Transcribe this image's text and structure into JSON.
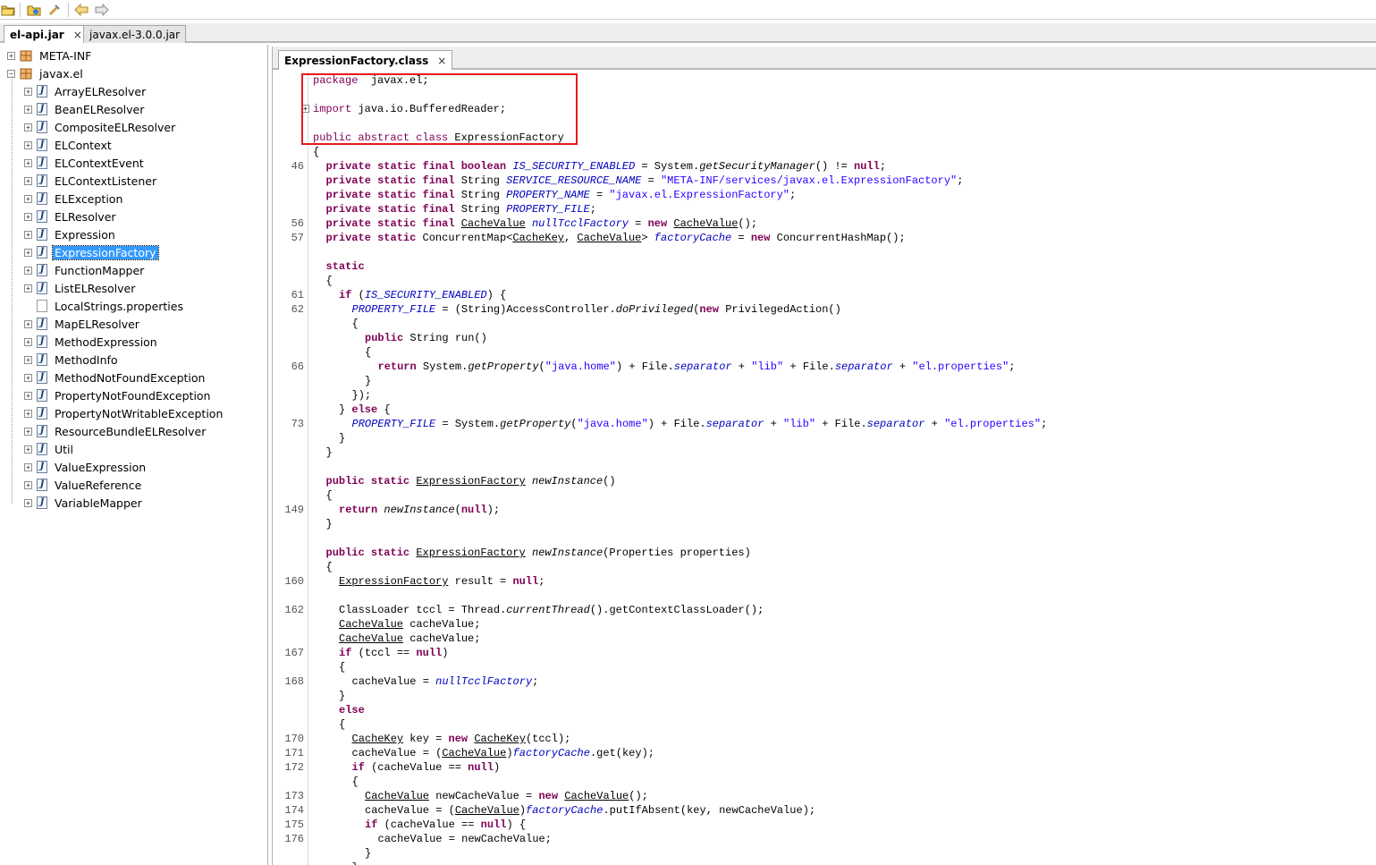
{
  "toolbar": {
    "buttons": [
      {
        "name": "open-file-icon",
        "glyph": "📂"
      },
      {
        "name": "open-jar-icon",
        "glyph": "📦"
      },
      {
        "name": "tools-icon",
        "glyph": "🔧"
      },
      {
        "name": "back-arrow-icon",
        "glyph": "⇦"
      },
      {
        "name": "forward-arrow-icon",
        "glyph": "⇨"
      }
    ]
  },
  "file_tabs": [
    {
      "label": "el-api.jar",
      "active": true,
      "close": "×"
    },
    {
      "label": "javax.el-3.0.0.jar",
      "active": false
    }
  ],
  "tree": {
    "roots": [
      {
        "label": "META-INF",
        "expander": "+"
      },
      {
        "label": "javax.el",
        "expander": "−"
      }
    ],
    "children": [
      {
        "label": "ArrayELResolver"
      },
      {
        "label": "BeanELResolver"
      },
      {
        "label": "CompositeELResolver"
      },
      {
        "label": "ELContext"
      },
      {
        "label": "ELContextEvent"
      },
      {
        "label": "ELContextListener"
      },
      {
        "label": "ELException"
      },
      {
        "label": "ELResolver"
      },
      {
        "label": "Expression"
      },
      {
        "label": "ExpressionFactory",
        "selected": true
      },
      {
        "label": "FunctionMapper"
      },
      {
        "label": "ListELResolver"
      },
      {
        "label": "LocalStrings.properties",
        "file": true
      },
      {
        "label": "MapELResolver"
      },
      {
        "label": "MethodExpression"
      },
      {
        "label": "MethodInfo"
      },
      {
        "label": "MethodNotFoundException"
      },
      {
        "label": "PropertyNotFoundException"
      },
      {
        "label": "PropertyNotWritableException"
      },
      {
        "label": "ResourceBundleELResolver"
      },
      {
        "label": "Util"
      },
      {
        "label": "ValueExpression"
      },
      {
        "label": "ValueReference"
      },
      {
        "label": "VariableMapper"
      }
    ]
  },
  "editor": {
    "tab_label": "ExpressionFactory.class",
    "tab_close": "×",
    "highlight_color": "#e8191b",
    "lines": [
      {
        "ln": "",
        "indent": 0,
        "parts": [
          [
            "kw2",
            "package"
          ],
          [
            "",
            "  javax.el;"
          ]
        ]
      },
      {
        "ln": "",
        "indent": 0,
        "parts": []
      },
      {
        "ln": "",
        "indent": 0,
        "fold": "+",
        "parts": [
          [
            "kw2",
            "import"
          ],
          [
            "",
            " java.io.BufferedReader;"
          ]
        ]
      },
      {
        "ln": "",
        "indent": 0,
        "parts": []
      },
      {
        "ln": "",
        "indent": 0,
        "parts": [
          [
            "kw2",
            "public abstract class"
          ],
          [
            "",
            " ExpressionFactory"
          ]
        ]
      },
      {
        "ln": "",
        "indent": 0,
        "parts": [
          [
            "",
            "{"
          ]
        ]
      },
      {
        "ln": "46",
        "indent": 1,
        "parts": [
          [
            "kw",
            "private static final boolean"
          ],
          [
            "",
            " "
          ],
          [
            "fld",
            "IS_SECURITY_ENABLED"
          ],
          [
            "",
            " = System."
          ],
          [
            "it",
            "getSecurityManager"
          ],
          [
            "",
            "() != "
          ],
          [
            "kw",
            "null"
          ],
          [
            "",
            ";"
          ]
        ]
      },
      {
        "ln": "",
        "indent": 1,
        "parts": [
          [
            "kw",
            "private static final"
          ],
          [
            "",
            " String "
          ],
          [
            "fld",
            "SERVICE_RESOURCE_NAME"
          ],
          [
            "",
            " = "
          ],
          [
            "str",
            "\"META-INF/services/javax.el.ExpressionFactory\""
          ],
          [
            "",
            ";"
          ]
        ]
      },
      {
        "ln": "",
        "indent": 1,
        "parts": [
          [
            "kw",
            "private static final"
          ],
          [
            "",
            " String "
          ],
          [
            "fld",
            "PROPERTY_NAME"
          ],
          [
            "",
            " = "
          ],
          [
            "str",
            "\"javax.el.ExpressionFactory\""
          ],
          [
            "",
            ";"
          ]
        ]
      },
      {
        "ln": "",
        "indent": 1,
        "parts": [
          [
            "kw",
            "private static final"
          ],
          [
            "",
            " String "
          ],
          [
            "fld",
            "PROPERTY_FILE"
          ],
          [
            "",
            ";"
          ]
        ]
      },
      {
        "ln": "56",
        "indent": 1,
        "parts": [
          [
            "kw",
            "private static final"
          ],
          [
            "",
            " "
          ],
          [
            "ul",
            "CacheValue"
          ],
          [
            "",
            " "
          ],
          [
            "fld",
            "nullTcclFactory"
          ],
          [
            "",
            " = "
          ],
          [
            "kw",
            "new"
          ],
          [
            "",
            " "
          ],
          [
            "ul",
            "CacheValue"
          ],
          [
            "",
            "();"
          ]
        ]
      },
      {
        "ln": "57",
        "indent": 1,
        "parts": [
          [
            "kw",
            "private static"
          ],
          [
            "",
            " ConcurrentMap<"
          ],
          [
            "ul",
            "CacheKey"
          ],
          [
            "",
            ", "
          ],
          [
            "ul",
            "CacheValue"
          ],
          [
            "",
            "> "
          ],
          [
            "fld",
            "factoryCache"
          ],
          [
            "",
            " = "
          ],
          [
            "kw",
            "new"
          ],
          [
            "",
            " ConcurrentHashMap();"
          ]
        ]
      },
      {
        "ln": "",
        "indent": 0,
        "parts": []
      },
      {
        "ln": "",
        "indent": 1,
        "parts": [
          [
            "kw",
            "static"
          ]
        ]
      },
      {
        "ln": "",
        "indent": 1,
        "parts": [
          [
            "",
            "{"
          ]
        ]
      },
      {
        "ln": "61",
        "indent": 2,
        "parts": [
          [
            "kw",
            "if"
          ],
          [
            "",
            " ("
          ],
          [
            "fld",
            "IS_SECURITY_ENABLED"
          ],
          [
            "",
            ") {"
          ]
        ]
      },
      {
        "ln": "62",
        "indent": 3,
        "parts": [
          [
            "fld",
            "PROPERTY_FILE"
          ],
          [
            "",
            " = (String)AccessController."
          ],
          [
            "it",
            "doPrivileged"
          ],
          [
            "",
            "("
          ],
          [
            "kw",
            "new"
          ],
          [
            "",
            " PrivilegedAction()"
          ]
        ]
      },
      {
        "ln": "",
        "indent": 3,
        "parts": [
          [
            "",
            "{"
          ]
        ]
      },
      {
        "ln": "",
        "indent": 4,
        "parts": [
          [
            "kw",
            "public"
          ],
          [
            "",
            " String run()"
          ]
        ]
      },
      {
        "ln": "",
        "indent": 4,
        "parts": [
          [
            "",
            "{"
          ]
        ]
      },
      {
        "ln": "66",
        "indent": 5,
        "parts": [
          [
            "kw",
            "return"
          ],
          [
            "",
            " System."
          ],
          [
            "it",
            "getProperty"
          ],
          [
            "",
            "("
          ],
          [
            "str",
            "\"java.home\""
          ],
          [
            "",
            ") + File."
          ],
          [
            "fld",
            "separator"
          ],
          [
            "",
            " + "
          ],
          [
            "str",
            "\"lib\""
          ],
          [
            "",
            " + File."
          ],
          [
            "fld",
            "separator"
          ],
          [
            "",
            " + "
          ],
          [
            "str",
            "\"el.properties\""
          ],
          [
            "",
            ";"
          ]
        ]
      },
      {
        "ln": "",
        "indent": 4,
        "parts": [
          [
            "",
            "}"
          ]
        ]
      },
      {
        "ln": "",
        "indent": 3,
        "parts": [
          [
            "",
            "});"
          ]
        ]
      },
      {
        "ln": "",
        "indent": 2,
        "parts": [
          [
            "",
            "} "
          ],
          [
            "kw",
            "else"
          ],
          [
            "",
            " {"
          ]
        ]
      },
      {
        "ln": "73",
        "indent": 3,
        "parts": [
          [
            "fld",
            "PROPERTY_FILE"
          ],
          [
            "",
            " = System."
          ],
          [
            "it",
            "getProperty"
          ],
          [
            "",
            "("
          ],
          [
            "str",
            "\"java.home\""
          ],
          [
            "",
            ") + File."
          ],
          [
            "fld",
            "separator"
          ],
          [
            "",
            " + "
          ],
          [
            "str",
            "\"lib\""
          ],
          [
            "",
            " + File."
          ],
          [
            "fld",
            "separator"
          ],
          [
            "",
            " + "
          ],
          [
            "str",
            "\"el.properties\""
          ],
          [
            "",
            ";"
          ]
        ]
      },
      {
        "ln": "",
        "indent": 2,
        "parts": [
          [
            "",
            "}"
          ]
        ]
      },
      {
        "ln": "",
        "indent": 1,
        "parts": [
          [
            "",
            "}"
          ]
        ]
      },
      {
        "ln": "",
        "indent": 0,
        "parts": []
      },
      {
        "ln": "",
        "indent": 1,
        "parts": [
          [
            "kw",
            "public static"
          ],
          [
            "",
            " "
          ],
          [
            "ul",
            "ExpressionFactory"
          ],
          [
            "",
            " "
          ],
          [
            "it",
            "newInstance"
          ],
          [
            "",
            "()"
          ]
        ]
      },
      {
        "ln": "",
        "indent": 1,
        "parts": [
          [
            "",
            "{"
          ]
        ]
      },
      {
        "ln": "149",
        "indent": 2,
        "parts": [
          [
            "kw",
            "return"
          ],
          [
            "",
            " "
          ],
          [
            "it",
            "newInstance"
          ],
          [
            "",
            "("
          ],
          [
            "kw",
            "null"
          ],
          [
            "",
            ");"
          ]
        ]
      },
      {
        "ln": "",
        "indent": 1,
        "parts": [
          [
            "",
            "}"
          ]
        ]
      },
      {
        "ln": "",
        "indent": 0,
        "parts": []
      },
      {
        "ln": "",
        "indent": 1,
        "parts": [
          [
            "kw",
            "public static"
          ],
          [
            "",
            " "
          ],
          [
            "ul",
            "ExpressionFactory"
          ],
          [
            "",
            " "
          ],
          [
            "it",
            "newInstance"
          ],
          [
            "",
            "(Properties properties)"
          ]
        ]
      },
      {
        "ln": "",
        "indent": 1,
        "parts": [
          [
            "",
            "{"
          ]
        ]
      },
      {
        "ln": "160",
        "indent": 2,
        "parts": [
          [
            "ul",
            "ExpressionFactory"
          ],
          [
            "",
            " result = "
          ],
          [
            "kw",
            "null"
          ],
          [
            "",
            ";"
          ]
        ]
      },
      {
        "ln": "",
        "indent": 0,
        "parts": []
      },
      {
        "ln": "162",
        "indent": 2,
        "parts": [
          [
            "",
            "ClassLoader tccl = Thread."
          ],
          [
            "it",
            "currentThread"
          ],
          [
            "",
            "().getContextClassLoader();"
          ]
        ]
      },
      {
        "ln": "",
        "indent": 2,
        "parts": [
          [
            "ul",
            "CacheValue"
          ],
          [
            "",
            " cacheValue;"
          ]
        ]
      },
      {
        "ln": "",
        "indent": 2,
        "parts": [
          [
            "ul",
            "CacheValue"
          ],
          [
            "",
            " cacheValue;"
          ]
        ]
      },
      {
        "ln": "167",
        "indent": 2,
        "parts": [
          [
            "kw",
            "if"
          ],
          [
            "",
            " (tccl == "
          ],
          [
            "kw",
            "null"
          ],
          [
            "",
            ")"
          ]
        ]
      },
      {
        "ln": "",
        "indent": 2,
        "parts": [
          [
            "",
            "{"
          ]
        ]
      },
      {
        "ln": "168",
        "indent": 3,
        "parts": [
          [
            "",
            "cacheValue = "
          ],
          [
            "fld",
            "nullTcclFactory"
          ],
          [
            "",
            ";"
          ]
        ]
      },
      {
        "ln": "",
        "indent": 2,
        "parts": [
          [
            "",
            "}"
          ]
        ]
      },
      {
        "ln": "",
        "indent": 2,
        "parts": [
          [
            "kw",
            "else"
          ]
        ]
      },
      {
        "ln": "",
        "indent": 2,
        "parts": [
          [
            "",
            "{"
          ]
        ]
      },
      {
        "ln": "170",
        "indent": 3,
        "parts": [
          [
            "ul",
            "CacheKey"
          ],
          [
            "",
            " key = "
          ],
          [
            "kw",
            "new"
          ],
          [
            "",
            " "
          ],
          [
            "ul",
            "CacheKey"
          ],
          [
            "",
            "(tccl);"
          ]
        ]
      },
      {
        "ln": "171",
        "indent": 3,
        "parts": [
          [
            "",
            "cacheValue = ("
          ],
          [
            "ul",
            "CacheValue"
          ],
          [
            "",
            ")"
          ],
          [
            "fld",
            "factoryCache"
          ],
          [
            "",
            ".get(key);"
          ]
        ]
      },
      {
        "ln": "172",
        "indent": 3,
        "parts": [
          [
            "kw",
            "if"
          ],
          [
            "",
            " (cacheValue == "
          ],
          [
            "kw",
            "null"
          ],
          [
            "",
            ")"
          ]
        ]
      },
      {
        "ln": "",
        "indent": 3,
        "parts": [
          [
            "",
            "{"
          ]
        ]
      },
      {
        "ln": "173",
        "indent": 4,
        "parts": [
          [
            "ul",
            "CacheValue"
          ],
          [
            "",
            " newCacheValue = "
          ],
          [
            "kw",
            "new"
          ],
          [
            "",
            " "
          ],
          [
            "ul",
            "CacheValue"
          ],
          [
            "",
            "();"
          ]
        ]
      },
      {
        "ln": "174",
        "indent": 4,
        "parts": [
          [
            "",
            "cacheValue = ("
          ],
          [
            "ul",
            "CacheValue"
          ],
          [
            "",
            ")"
          ],
          [
            "fld",
            "factoryCache"
          ],
          [
            "",
            ".putIfAbsent(key, newCacheValue);"
          ]
        ]
      },
      {
        "ln": "175",
        "indent": 4,
        "parts": [
          [
            "kw",
            "if"
          ],
          [
            "",
            " (cacheValue == "
          ],
          [
            "kw",
            "null"
          ],
          [
            "",
            ") {"
          ]
        ]
      },
      {
        "ln": "176",
        "indent": 5,
        "parts": [
          [
            "",
            "cacheValue = newCacheValue;"
          ]
        ]
      },
      {
        "ln": "",
        "indent": 4,
        "parts": [
          [
            "",
            "}"
          ]
        ]
      },
      {
        "ln": "",
        "indent": 3,
        "parts": [
          [
            "",
            "}"
          ]
        ]
      }
    ]
  }
}
